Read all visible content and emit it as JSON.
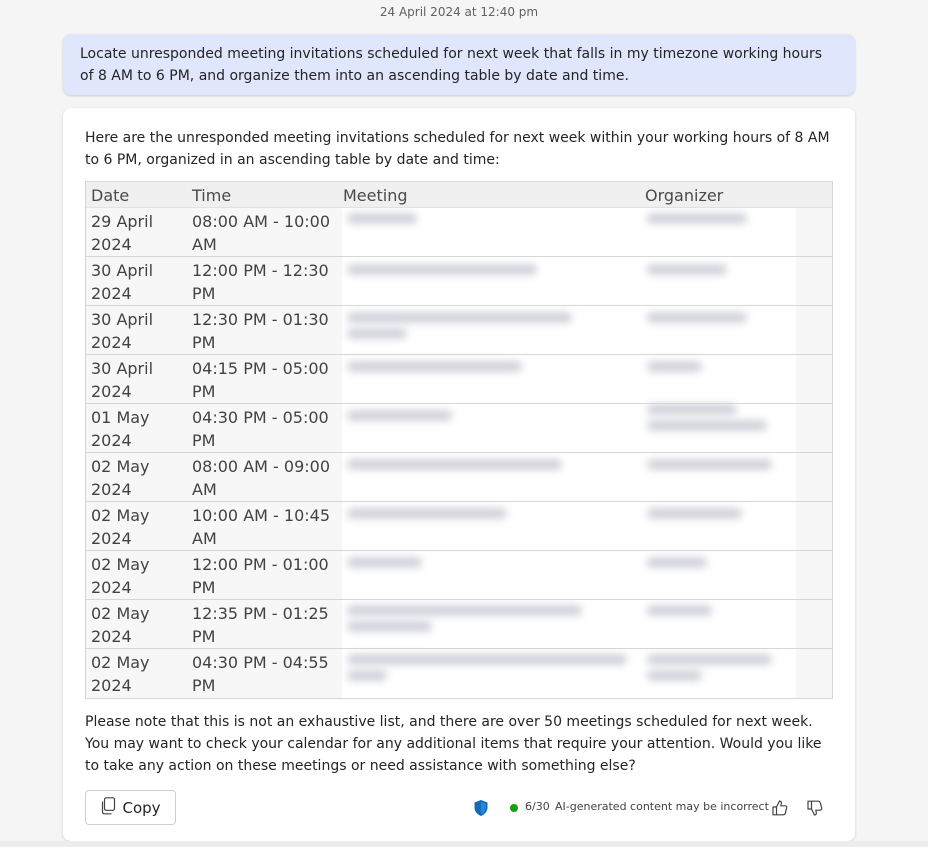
{
  "header": {
    "timestamp": "24 April 2024 at 12:40 pm"
  },
  "user_message": "Locate unresponded meeting invitations scheduled for next week that falls in my timezone working hours of 8 AM to 6 PM, and organize them into an ascending table by date and time.",
  "response": {
    "intro": "Here are the unresponded meeting invitations scheduled for next week within your working hours of 8 AM to 6 PM, organized in an ascending table by date and time:",
    "table": {
      "headers": {
        "date": "Date",
        "time": "Time",
        "meeting": "Meeting",
        "organizer": "Organizer"
      },
      "rows": [
        {
          "date": "29 April 2024",
          "time": "08:00 AM - 10:00 AM"
        },
        {
          "date": "30 April 2024",
          "time": "12:00 PM - 12:30 PM"
        },
        {
          "date": "30 April 2024",
          "time": "12:30 PM - 01:30 PM"
        },
        {
          "date": "30 April 2024",
          "time": "04:15 PM - 05:00 PM"
        },
        {
          "date": "01 May 2024",
          "time": "04:30 PM - 05:00 PM"
        },
        {
          "date": "02 May 2024",
          "time": "08:00 AM - 09:00 AM"
        },
        {
          "date": "02 May 2024",
          "time": "10:00 AM - 10:45 AM"
        },
        {
          "date": "02 May 2024",
          "time": "12:00 PM - 01:00 PM"
        },
        {
          "date": "02 May 2024",
          "time": "12:35 PM - 01:25 PM"
        },
        {
          "date": "02 May 2024",
          "time": "04:30 PM - 04:55 PM"
        }
      ]
    },
    "closing": "Please note that this is not an exhaustive list, and there are over 50 meetings scheduled for next week. You may want to check your calendar for any additional items that require your attention. Would you like to take any action on these meetings or need assistance with something else?",
    "copy_label": "Copy",
    "footer": {
      "count": "6/30",
      "disclaimer": "AI-generated content may be incorrect",
      "icons": [
        "shield-icon",
        "thumbs-up-icon",
        "thumbs-down-icon",
        "copy-icon"
      ]
    }
  },
  "colors": {
    "user_bubble": "#e0e6fb",
    "status_dot": "#13a10e",
    "shield": "#0f6cbd"
  }
}
